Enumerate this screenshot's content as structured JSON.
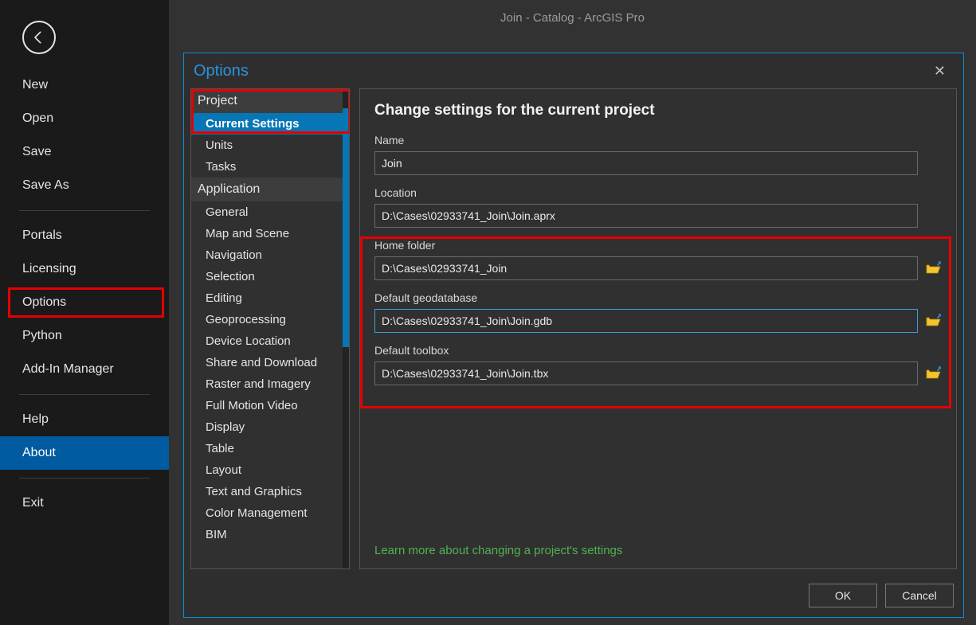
{
  "window": {
    "title": "Join - Catalog - ArcGIS Pro"
  },
  "backstage": {
    "items": [
      {
        "label": "New"
      },
      {
        "label": "Open"
      },
      {
        "label": "Save"
      },
      {
        "label": "Save As"
      },
      {
        "sep": true
      },
      {
        "label": "Portals"
      },
      {
        "label": "Licensing"
      },
      {
        "label": "Options",
        "highlighted": true
      },
      {
        "label": "Python"
      },
      {
        "label": "Add-In Manager"
      },
      {
        "sep": true
      },
      {
        "label": "Help"
      },
      {
        "label": "About",
        "selected": true
      },
      {
        "sep": true
      },
      {
        "label": "Exit"
      }
    ]
  },
  "dialog": {
    "title": "Options",
    "tree": {
      "groups": [
        {
          "header": "Project",
          "items": [
            {
              "label": "Current Settings",
              "selected": true
            },
            {
              "label": "Units"
            },
            {
              "label": "Tasks"
            }
          ]
        },
        {
          "header": "Application",
          "items": [
            {
              "label": "General"
            },
            {
              "label": "Map and Scene"
            },
            {
              "label": "Navigation"
            },
            {
              "label": "Selection"
            },
            {
              "label": "Editing"
            },
            {
              "label": "Geoprocessing"
            },
            {
              "label": "Device Location"
            },
            {
              "label": "Share and Download"
            },
            {
              "label": "Raster and Imagery"
            },
            {
              "label": "Full Motion Video"
            },
            {
              "label": "Display"
            },
            {
              "label": "Table"
            },
            {
              "label": "Layout"
            },
            {
              "label": "Text and Graphics"
            },
            {
              "label": "Color Management"
            },
            {
              "label": "BIM"
            }
          ]
        }
      ]
    },
    "panel": {
      "heading": "Change settings for the current project",
      "name_label": "Name",
      "name_value": "Join",
      "location_label": "Location",
      "location_value": "D:\\Cases\\02933741_Join\\Join.aprx",
      "home_label": "Home folder",
      "home_value": "D:\\Cases\\02933741_Join",
      "gdb_label": "Default geodatabase",
      "gdb_value": "D:\\Cases\\02933741_Join\\Join.gdb",
      "tbx_label": "Default toolbox",
      "tbx_value": "D:\\Cases\\02933741_Join\\Join.tbx",
      "learn_more": "Learn more about changing a project's settings"
    },
    "buttons": {
      "ok": "OK",
      "cancel": "Cancel"
    }
  }
}
